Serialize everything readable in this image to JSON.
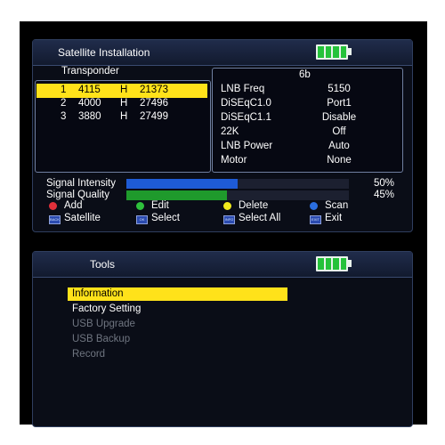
{
  "satellite_panel": {
    "title": "Satellite Installation",
    "transponder_heading": "Transponder",
    "transponders": [
      {
        "index": "1",
        "freq": "4115",
        "pol": "H",
        "symbol": "21373",
        "selected": true
      },
      {
        "index": "2",
        "freq": "4000",
        "pol": "H",
        "symbol": "27496",
        "selected": false
      },
      {
        "index": "3",
        "freq": "3880",
        "pol": "H",
        "symbol": "27499",
        "selected": false
      }
    ],
    "satellite_name": "6b",
    "settings": [
      {
        "label": "LNB Freq",
        "value": "5150"
      },
      {
        "label": "DiSEqC1.0",
        "value": "Port1"
      },
      {
        "label": "DiSEqC1.1",
        "value": "Disable"
      },
      {
        "label": "22K",
        "value": "Off"
      },
      {
        "label": "LNB Power",
        "value": "Auto"
      },
      {
        "label": "Motor",
        "value": "None"
      }
    ],
    "signal_intensity": {
      "label": "Signal Intensity",
      "value": "50%",
      "fraction": 0.5
    },
    "signal_quality": {
      "label": "Signal Quality",
      "value": "45%",
      "fraction": 0.45
    },
    "legend": [
      {
        "icon": "red-dot",
        "label": "Add",
        "color": "#e0303a"
      },
      {
        "icon": "green-dot",
        "label": "Edit",
        "color": "#2ec03c"
      },
      {
        "icon": "yellow-dot",
        "label": "Delete",
        "color": "#f0ea1c"
      },
      {
        "icon": "blue-dot",
        "label": "Scan",
        "color": "#2a6ee0"
      },
      {
        "icon": "back-key-icon",
        "label": "Satellite",
        "key": "BACK"
      },
      {
        "icon": "ok-key-icon",
        "label": "Select",
        "key": "OK"
      },
      {
        "icon": "info-key-icon",
        "label": "Select All",
        "key": "INFO"
      },
      {
        "icon": "exit-key-icon",
        "label": "Exit",
        "key": "EXIT"
      }
    ]
  },
  "tools_panel": {
    "title": "Tools",
    "items": [
      {
        "label": "Information",
        "selected": true,
        "enabled": true
      },
      {
        "label": "Factory Setting",
        "selected": false,
        "enabled": true
      },
      {
        "label": "USB Upgrade",
        "selected": false,
        "enabled": false
      },
      {
        "label": "USB Backup",
        "selected": false,
        "enabled": false
      },
      {
        "label": "Record",
        "selected": false,
        "enabled": false
      }
    ]
  },
  "colors": {
    "highlight": "#ffe21a",
    "intensity_bar": "#1e5bd6",
    "quality_bar": "#1f9a2c",
    "battery": "#25c23a"
  }
}
